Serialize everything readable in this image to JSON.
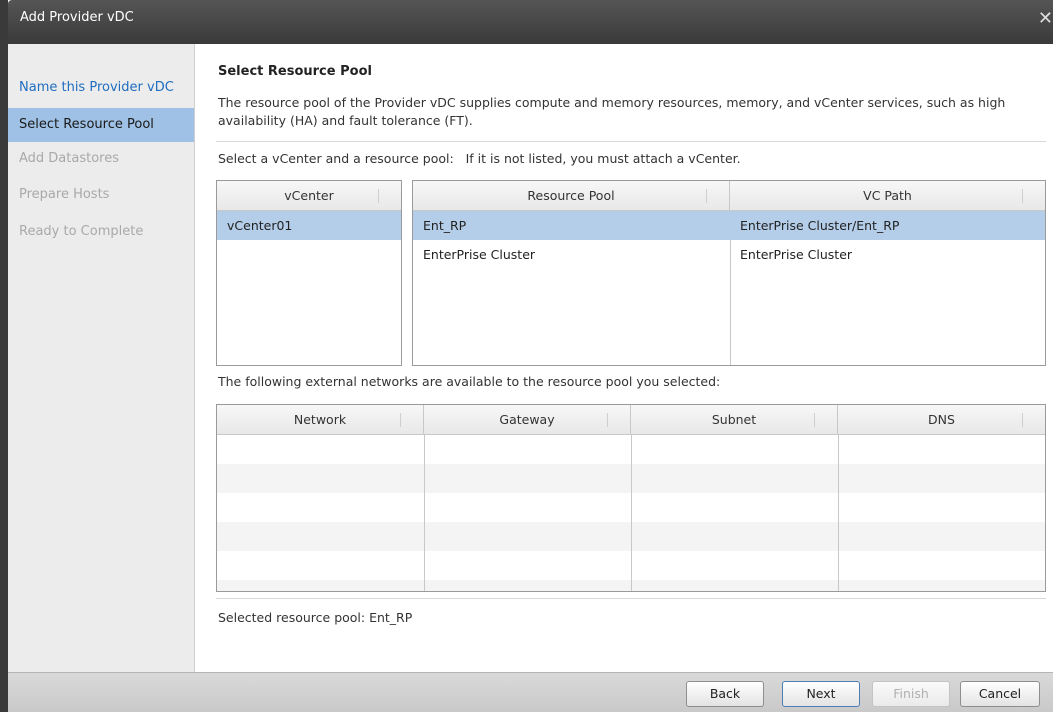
{
  "window": {
    "title": "Add Provider vDC",
    "close_glyph": "✕"
  },
  "sidebar": {
    "items": [
      {
        "label": "Name this Provider vDC",
        "state": "done"
      },
      {
        "label": "Select Resource Pool",
        "state": "active"
      },
      {
        "label": "Add Datastores",
        "state": "disabled"
      },
      {
        "label": "Prepare Hosts",
        "state": "disabled"
      },
      {
        "label": "Ready to Complete",
        "state": "disabled"
      }
    ]
  },
  "main": {
    "heading": "Select Resource Pool",
    "description": "The resource pool of the Provider vDC supplies compute and memory resources, memory, and vCenter services, such as high availability (HA) and fault tolerance (FT).",
    "prompt": "Select a vCenter and a resource pool:   If it is not listed, you must attach a vCenter.",
    "vcenter_table": {
      "header": "vCenter",
      "rows": [
        "vCenter01"
      ]
    },
    "pool_table": {
      "headers": [
        "Resource Pool",
        "VC Path"
      ],
      "rows": [
        {
          "pool": "Ent_RP",
          "path": "EnterPrise Cluster/Ent_RP"
        },
        {
          "pool": "EnterPrise Cluster",
          "path": "EnterPrise Cluster"
        }
      ]
    },
    "networks_label": "The following external networks are available to the resource pool you selected:",
    "network_table": {
      "headers": [
        "Network",
        "Gateway",
        "Subnet",
        "DNS"
      ]
    },
    "selected_pool": "Selected resource pool: Ent_RP"
  },
  "footer": {
    "back_label": "Back",
    "next_label": "Next",
    "finish_label": "Finish",
    "cancel_label": "Cancel"
  },
  "colors": {
    "selection": "#b4cde8",
    "active_nav": "#9fc1e5",
    "link": "#1f6dbf",
    "titlebar": "#3a3a3a"
  }
}
